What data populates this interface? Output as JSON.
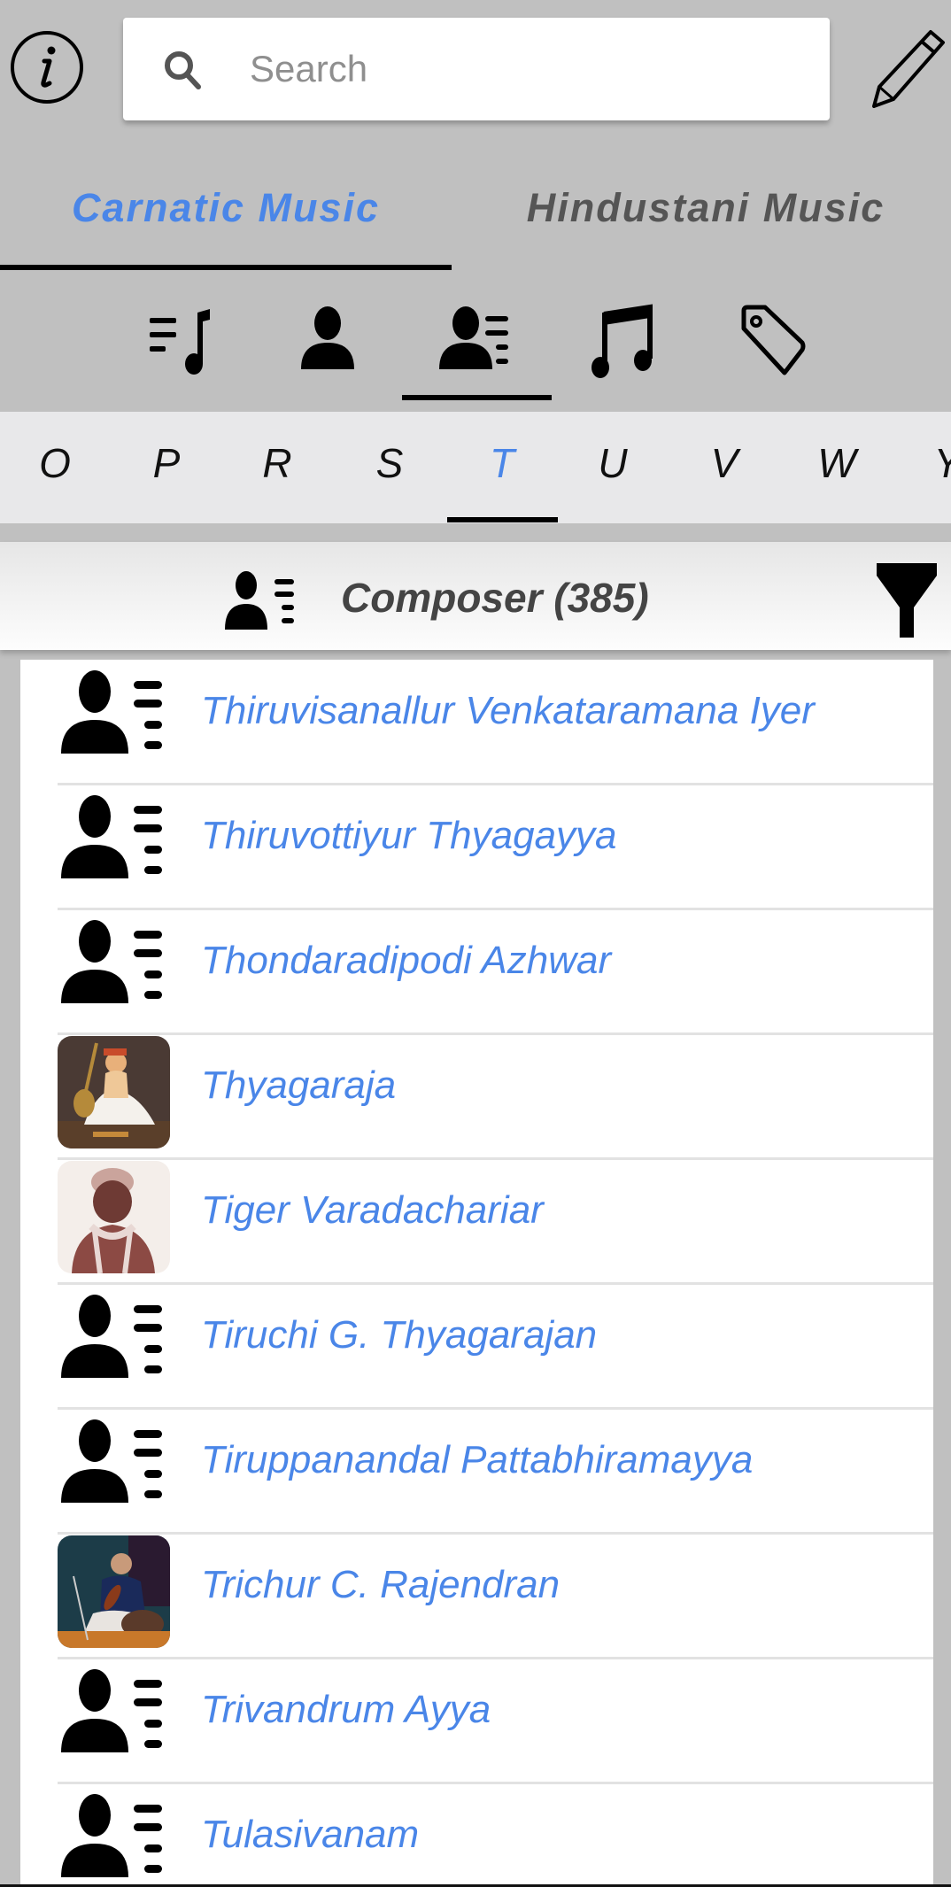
{
  "header": {
    "info_icon": "info-icon",
    "search": {
      "placeholder": "Search",
      "value": "",
      "icon": "search-icon"
    },
    "edit_icon": "pencil-icon"
  },
  "main_tabs": [
    {
      "label": "Carnatic Music",
      "active": true
    },
    {
      "label": "Hindustani Music",
      "active": false
    }
  ],
  "category_tabs": [
    {
      "icon": "playlist-music-icon",
      "active": false
    },
    {
      "icon": "person-icon",
      "active": false
    },
    {
      "icon": "person-list-icon",
      "active": true
    },
    {
      "icon": "music-note-icon",
      "active": false
    },
    {
      "icon": "tag-icon",
      "active": false
    }
  ],
  "letters": {
    "items": [
      "O",
      "P",
      "R",
      "S",
      "T",
      "U",
      "V",
      "W",
      "Y"
    ],
    "active": "T"
  },
  "section_header": {
    "icon": "person-list-icon",
    "title": "Composer (385)",
    "filter_icon": "filter-icon"
  },
  "composers": [
    {
      "name": "Thiruvisanallur Venkataramana Iyer",
      "thumb": "placeholder"
    },
    {
      "name": "Thiruvottiyur Thyagayya",
      "thumb": "placeholder"
    },
    {
      "name": "Thondaradipodi Azhwar",
      "thumb": "placeholder"
    },
    {
      "name": "Thyagaraja",
      "thumb": "photo"
    },
    {
      "name": "Tiger Varadachariar",
      "thumb": "photo"
    },
    {
      "name": "Tiruchi G. Thyagarajan",
      "thumb": "placeholder"
    },
    {
      "name": "Tiruppanandal Pattabhiramayya",
      "thumb": "placeholder"
    },
    {
      "name": "Trichur C. Rajendran",
      "thumb": "photo"
    },
    {
      "name": "Trivandrum Ayya",
      "thumb": "placeholder"
    },
    {
      "name": "Tulasivanam",
      "thumb": "placeholder"
    }
  ],
  "colors": {
    "accent": "#4a86e8",
    "background": "#c0c0c0",
    "letter_bar": "#e8e8ea"
  }
}
